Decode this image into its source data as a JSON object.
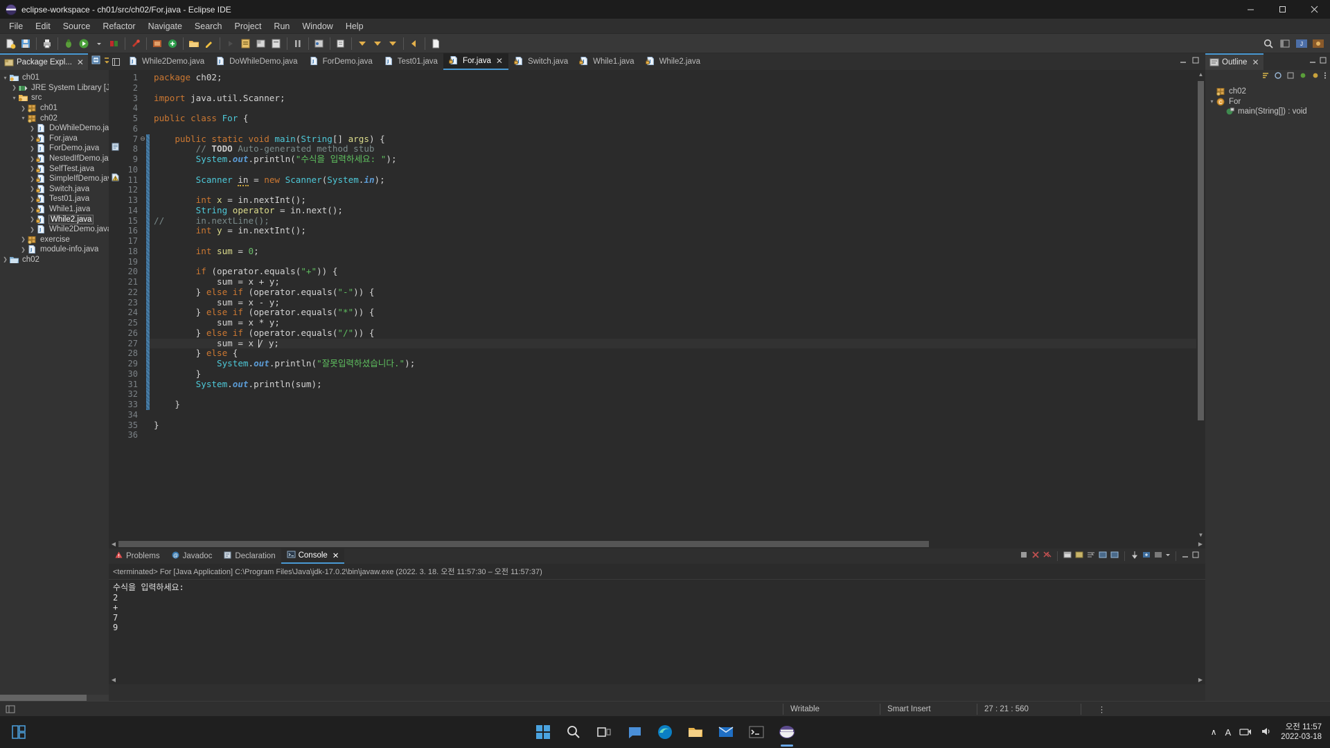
{
  "window": {
    "title": "eclipse-workspace - ch01/src/ch02/For.java - Eclipse IDE",
    "minimize_label": "—",
    "maximize_label": "❐",
    "close_label": "✕"
  },
  "menubar": {
    "items": [
      "File",
      "Edit",
      "Source",
      "Refactor",
      "Navigate",
      "Search",
      "Project",
      "Run",
      "Window",
      "Help"
    ]
  },
  "package_explorer": {
    "tab_label": "Package Expl...",
    "close_label": "✕",
    "tree": [
      {
        "label": "ch01",
        "indent": 0,
        "arrow": "down",
        "icon": "java-project-icon",
        "selected": false
      },
      {
        "label": "JRE System Library [JavaS",
        "indent": 1,
        "arrow": "right",
        "icon": "library-icon",
        "selected": false
      },
      {
        "label": "src",
        "indent": 1,
        "arrow": "down",
        "icon": "source-folder-icon",
        "selected": false
      },
      {
        "label": "ch01",
        "indent": 2,
        "arrow": "right",
        "icon": "package-icon",
        "selected": false
      },
      {
        "label": "ch02",
        "indent": 2,
        "arrow": "down",
        "icon": "package-icon",
        "selected": false
      },
      {
        "label": "DoWhileDemo.java",
        "indent": 3,
        "arrow": "right",
        "icon": "java-file-icon",
        "selected": false
      },
      {
        "label": "For.java",
        "indent": 3,
        "arrow": "right",
        "icon": "java-file-lock-icon",
        "selected": false
      },
      {
        "label": "ForDemo.java",
        "indent": 3,
        "arrow": "right",
        "icon": "java-file-icon",
        "selected": false
      },
      {
        "label": "NestedIfDemo.java",
        "indent": 3,
        "arrow": "right",
        "icon": "java-file-lock-icon",
        "selected": false
      },
      {
        "label": "SelfTest.java",
        "indent": 3,
        "arrow": "right",
        "icon": "java-file-lock-icon",
        "selected": false
      },
      {
        "label": "SimpleIfDemo.java",
        "indent": 3,
        "arrow": "right",
        "icon": "java-file-lock-icon",
        "selected": false
      },
      {
        "label": "Switch.java",
        "indent": 3,
        "arrow": "right",
        "icon": "java-file-lock-icon",
        "selected": false
      },
      {
        "label": "Test01.java",
        "indent": 3,
        "arrow": "right",
        "icon": "java-file-lock-icon",
        "selected": false
      },
      {
        "label": "While1.java",
        "indent": 3,
        "arrow": "right",
        "icon": "java-file-lock-icon",
        "selected": false
      },
      {
        "label": "While2.java",
        "indent": 3,
        "arrow": "right",
        "icon": "java-file-lock-icon",
        "selected": true
      },
      {
        "label": "While2Demo.java",
        "indent": 3,
        "arrow": "right",
        "icon": "java-file-icon",
        "selected": false
      },
      {
        "label": "exercise",
        "indent": 2,
        "arrow": "right",
        "icon": "package-icon",
        "selected": false
      },
      {
        "label": "module-info.java",
        "indent": 2,
        "arrow": "right",
        "icon": "java-file-icon",
        "selected": false
      },
      {
        "label": "ch02",
        "indent": 0,
        "arrow": "right",
        "icon": "closed-project-icon",
        "selected": false
      }
    ]
  },
  "editor": {
    "tabs": [
      {
        "label": "While2Demo.java",
        "active": false,
        "icon": "java-file-icon"
      },
      {
        "label": "DoWhileDemo.java",
        "active": false,
        "icon": "java-file-icon"
      },
      {
        "label": "ForDemo.java",
        "active": false,
        "icon": "java-file-icon"
      },
      {
        "label": "Test01.java",
        "active": false,
        "icon": "java-file-icon"
      },
      {
        "label": "For.java",
        "active": true,
        "icon": "java-file-lock-icon",
        "close_label": "✕"
      },
      {
        "label": "Switch.java",
        "active": false,
        "icon": "java-file-lock-icon"
      },
      {
        "label": "While1.java",
        "active": false,
        "icon": "java-file-lock-icon"
      },
      {
        "label": "While2.java",
        "active": false,
        "icon": "java-file-lock-icon"
      }
    ],
    "first_line": 1,
    "last_line": 36,
    "current_line": 27,
    "lines": [
      {
        "n": 1,
        "tokens": [
          {
            "t": "package ",
            "c": "kw2"
          },
          {
            "t": "ch02;",
            "c": "plain"
          }
        ]
      },
      {
        "n": 2,
        "tokens": []
      },
      {
        "n": 3,
        "tokens": [
          {
            "t": "import ",
            "c": "kw2"
          },
          {
            "t": "java.util.Scanner;",
            "c": "plain"
          }
        ]
      },
      {
        "n": 4,
        "tokens": []
      },
      {
        "n": 5,
        "tokens": [
          {
            "t": "public class ",
            "c": "kw2"
          },
          {
            "t": "For",
            "c": "cls"
          },
          {
            "t": " {",
            "c": "plain"
          }
        ]
      },
      {
        "n": 6,
        "tokens": []
      },
      {
        "n": 7,
        "fold": true,
        "marker": "method-overview",
        "tokens": [
          {
            "t": "    ",
            "c": "plain"
          },
          {
            "t": "public static void ",
            "c": "kw2"
          },
          {
            "t": "main",
            "c": "mth-teal"
          },
          {
            "t": "(",
            "c": "plain"
          },
          {
            "t": "String",
            "c": "cls"
          },
          {
            "t": "[] ",
            "c": "plain"
          },
          {
            "t": "args",
            "c": "var"
          },
          {
            "t": ") {",
            "c": "plain"
          }
        ]
      },
      {
        "n": 8,
        "marker": "todo-icon",
        "tokens": [
          {
            "t": "        ",
            "c": "plain"
          },
          {
            "t": "// ",
            "c": "cmt"
          },
          {
            "t": "TODO",
            "c": "cmt-bold"
          },
          {
            "t": " Auto-generated method stub",
            "c": "cmt"
          }
        ]
      },
      {
        "n": 9,
        "tokens": [
          {
            "t": "        ",
            "c": "plain"
          },
          {
            "t": "System",
            "c": "cls"
          },
          {
            "t": ".",
            "c": "plain"
          },
          {
            "t": "out",
            "c": "fld"
          },
          {
            "t": ".println(",
            "c": "plain"
          },
          {
            "t": "\"수식을 입력하세요: \"",
            "c": "str"
          },
          {
            "t": ");",
            "c": "plain"
          }
        ]
      },
      {
        "n": 10,
        "tokens": []
      },
      {
        "n": 11,
        "marker": "warning-icon",
        "tokens": [
          {
            "t": "        ",
            "c": "plain"
          },
          {
            "t": "Scanner",
            "c": "cls"
          },
          {
            "t": " ",
            "c": "plain"
          },
          {
            "t": "in",
            "c": "plain-squig"
          },
          {
            "t": " = ",
            "c": "plain"
          },
          {
            "t": "new ",
            "c": "kw2"
          },
          {
            "t": "Scanner",
            "c": "cls"
          },
          {
            "t": "(",
            "c": "plain"
          },
          {
            "t": "System",
            "c": "cls"
          },
          {
            "t": ".",
            "c": "plain"
          },
          {
            "t": "in",
            "c": "fld"
          },
          {
            "t": ");",
            "c": "plain"
          }
        ]
      },
      {
        "n": 12,
        "tokens": []
      },
      {
        "n": 13,
        "tokens": [
          {
            "t": "        ",
            "c": "plain"
          },
          {
            "t": "int ",
            "c": "kw2"
          },
          {
            "t": "x",
            "c": "var"
          },
          {
            "t": " = in.",
            "c": "plain"
          },
          {
            "t": "nextInt",
            "c": "plain"
          },
          {
            "t": "();",
            "c": "plain"
          }
        ]
      },
      {
        "n": 14,
        "tokens": [
          {
            "t": "        ",
            "c": "plain"
          },
          {
            "t": "String",
            "c": "cls"
          },
          {
            "t": " ",
            "c": "plain"
          },
          {
            "t": "operator",
            "c": "var"
          },
          {
            "t": " = in.next();",
            "c": "plain"
          }
        ]
      },
      {
        "n": 15,
        "tokens": [
          {
            "t": "//      ",
            "c": "cmt"
          },
          {
            "t": "in.nextLine();",
            "c": "cmt"
          }
        ]
      },
      {
        "n": 16,
        "tokens": [
          {
            "t": "        ",
            "c": "plain"
          },
          {
            "t": "int ",
            "c": "kw2"
          },
          {
            "t": "y",
            "c": "var"
          },
          {
            "t": " = in.nextInt();",
            "c": "plain"
          }
        ]
      },
      {
        "n": 17,
        "tokens": []
      },
      {
        "n": 18,
        "tokens": [
          {
            "t": "        ",
            "c": "plain"
          },
          {
            "t": "int ",
            "c": "kw2"
          },
          {
            "t": "sum",
            "c": "var"
          },
          {
            "t": " = ",
            "c": "plain"
          },
          {
            "t": "0",
            "c": "num"
          },
          {
            "t": ";",
            "c": "plain"
          }
        ]
      },
      {
        "n": 19,
        "tokens": []
      },
      {
        "n": 20,
        "tokens": [
          {
            "t": "        ",
            "c": "plain"
          },
          {
            "t": "if ",
            "c": "kw2"
          },
          {
            "t": "(operator.equals(",
            "c": "plain"
          },
          {
            "t": "\"+\"",
            "c": "str"
          },
          {
            "t": ")) {",
            "c": "plain"
          }
        ]
      },
      {
        "n": 21,
        "tokens": [
          {
            "t": "            sum = x + y;",
            "c": "plain"
          }
        ]
      },
      {
        "n": 22,
        "tokens": [
          {
            "t": "        } ",
            "c": "plain"
          },
          {
            "t": "else if ",
            "c": "kw2"
          },
          {
            "t": "(operator.equals(",
            "c": "plain"
          },
          {
            "t": "\"-\"",
            "c": "str"
          },
          {
            "t": ")) {",
            "c": "plain"
          }
        ]
      },
      {
        "n": 23,
        "tokens": [
          {
            "t": "            sum = x - y;",
            "c": "plain"
          }
        ]
      },
      {
        "n": 24,
        "tokens": [
          {
            "t": "        } ",
            "c": "plain"
          },
          {
            "t": "else if ",
            "c": "kw2"
          },
          {
            "t": "(operator.equals(",
            "c": "plain"
          },
          {
            "t": "\"*\"",
            "c": "str"
          },
          {
            "t": ")) {",
            "c": "plain"
          }
        ]
      },
      {
        "n": 25,
        "tokens": [
          {
            "t": "            sum = x * y;",
            "c": "plain"
          }
        ]
      },
      {
        "n": 26,
        "tokens": [
          {
            "t": "        } ",
            "c": "plain"
          },
          {
            "t": "else if ",
            "c": "kw2"
          },
          {
            "t": "(operator.equals(",
            "c": "plain"
          },
          {
            "t": "\"/\"",
            "c": "str"
          },
          {
            "t": ")) {",
            "c": "plain"
          }
        ]
      },
      {
        "n": 27,
        "current": true,
        "tokens": [
          {
            "t": "            sum = x ",
            "c": "plain"
          },
          {
            "t": "|",
            "c": "caret"
          },
          {
            "t": "/ y;",
            "c": "plain"
          }
        ]
      },
      {
        "n": 28,
        "tokens": [
          {
            "t": "        } ",
            "c": "plain"
          },
          {
            "t": "else ",
            "c": "kw2"
          },
          {
            "t": "{",
            "c": "plain"
          }
        ]
      },
      {
        "n": 29,
        "tokens": [
          {
            "t": "            ",
            "c": "plain"
          },
          {
            "t": "System",
            "c": "cls"
          },
          {
            "t": ".",
            "c": "plain"
          },
          {
            "t": "out",
            "c": "fld"
          },
          {
            "t": ".println(",
            "c": "plain"
          },
          {
            "t": "\"잘못입력하셨습니다.\"",
            "c": "str"
          },
          {
            "t": ");",
            "c": "plain"
          }
        ]
      },
      {
        "n": 30,
        "tokens": [
          {
            "t": "        }",
            "c": "plain"
          }
        ]
      },
      {
        "n": 31,
        "tokens": [
          {
            "t": "        ",
            "c": "plain"
          },
          {
            "t": "System",
            "c": "cls"
          },
          {
            "t": ".",
            "c": "plain"
          },
          {
            "t": "out",
            "c": "fld"
          },
          {
            "t": ".println(sum);",
            "c": "plain"
          }
        ]
      },
      {
        "n": 32,
        "tokens": []
      },
      {
        "n": 33,
        "tokens": [
          {
            "t": "    }",
            "c": "plain"
          }
        ]
      },
      {
        "n": 34,
        "tokens": []
      },
      {
        "n": 35,
        "tokens": [
          {
            "t": "}",
            "c": "plain"
          }
        ]
      },
      {
        "n": 36,
        "tokens": []
      }
    ]
  },
  "console": {
    "tabs": [
      {
        "label": "Problems",
        "active": false,
        "icon": "problems-icon"
      },
      {
        "label": "Javadoc",
        "active": false,
        "icon": "javadoc-icon"
      },
      {
        "label": "Declaration",
        "active": false,
        "icon": "declaration-icon"
      },
      {
        "label": "Console",
        "active": true,
        "icon": "console-icon",
        "close_label": "✕"
      }
    ],
    "terminated_line": "<terminated> For [Java Application] C:\\Program Files\\Java\\jdk-17.0.2\\bin\\javaw.exe  (2022. 3. 18. 오전 11:57:30 – 오전 11:57:37)",
    "output": "수식을 입력하세요: \n2\n+\n7\n9"
  },
  "outline": {
    "tab_label": "Outline",
    "close_label": "✕",
    "tree": [
      {
        "label": "ch02",
        "indent": 0,
        "arrow": "none",
        "icon": "package-icon"
      },
      {
        "label": "For",
        "indent": 0,
        "arrow": "down",
        "icon": "class-icon"
      },
      {
        "label": "main(String[]) : void",
        "indent": 1,
        "arrow": "none",
        "icon": "method-icon"
      }
    ]
  },
  "statusbar": {
    "writable": "Writable",
    "insert_mode": "Smart Insert",
    "position": "27 : 21 : 560",
    "more_label": "⋮"
  },
  "taskbar": {
    "clock_time": "오전 11:57",
    "clock_date": "2022-03-18",
    "lang_indicator": "A",
    "chevron_label": "∧",
    "icons": [
      {
        "name": "start-icon"
      },
      {
        "name": "search-icon"
      },
      {
        "name": "task-view-icon"
      },
      {
        "name": "chat-icon"
      },
      {
        "name": "edge-icon"
      },
      {
        "name": "file-explorer-icon"
      },
      {
        "name": "mail-icon"
      },
      {
        "name": "terminal-icon"
      },
      {
        "name": "eclipse-icon"
      }
    ]
  },
  "colors": {
    "accent": "#4a9ad4",
    "editor_bg": "#2b2b2b",
    "panel_bg": "#2f2f2f",
    "tree_bg": "#333333",
    "keyword": "#cc7832",
    "string": "#5fbf5f",
    "comment": "#7a8b8b",
    "type": "#4ec9d9",
    "field": "#5b9bd5",
    "variable": "#dcdc8c"
  }
}
